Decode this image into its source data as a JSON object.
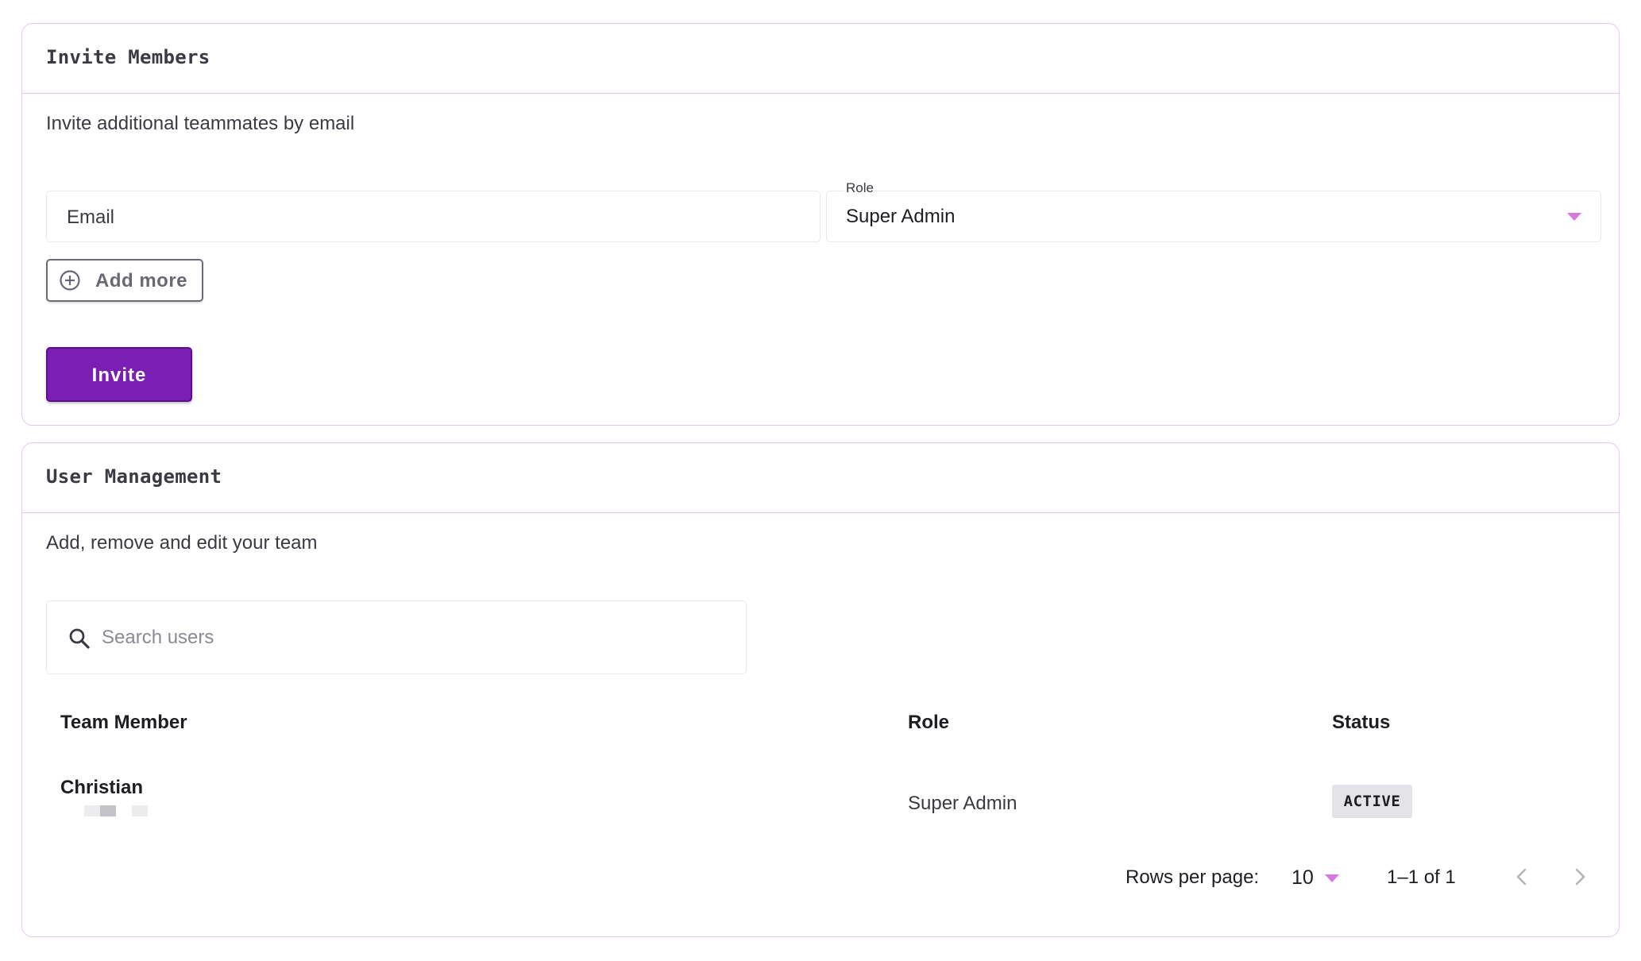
{
  "invite": {
    "title": "Invite Members",
    "subtitle": "Invite additional teammates by email",
    "email_placeholder": "Email",
    "role_label": "Role",
    "role_value": "Super Admin",
    "add_more_label": "Add more",
    "invite_label": "Invite"
  },
  "users": {
    "title": "User Management",
    "subtitle": "Add, remove and edit your team",
    "search_placeholder": "Search users",
    "columns": [
      "Team Member",
      "Role",
      "Status"
    ],
    "rows": [
      {
        "name": "Christian",
        "role": "Super Admin",
        "status": "ACTIVE"
      }
    ],
    "pagination": {
      "rows_per_page_label": "Rows per page:",
      "rows_per_page_value": "10",
      "range": "1–1 of 1"
    }
  },
  "colors": {
    "accent": "#7b1fb4",
    "border": "#e6c6ef",
    "caret": "#d977e0",
    "badge_bg": "#e4e4e8"
  },
  "icons": {
    "add": "plus-circle-icon",
    "search": "search-icon",
    "prev": "chevron-left-icon",
    "next": "chevron-right-icon",
    "dropdown": "caret-down-icon"
  }
}
